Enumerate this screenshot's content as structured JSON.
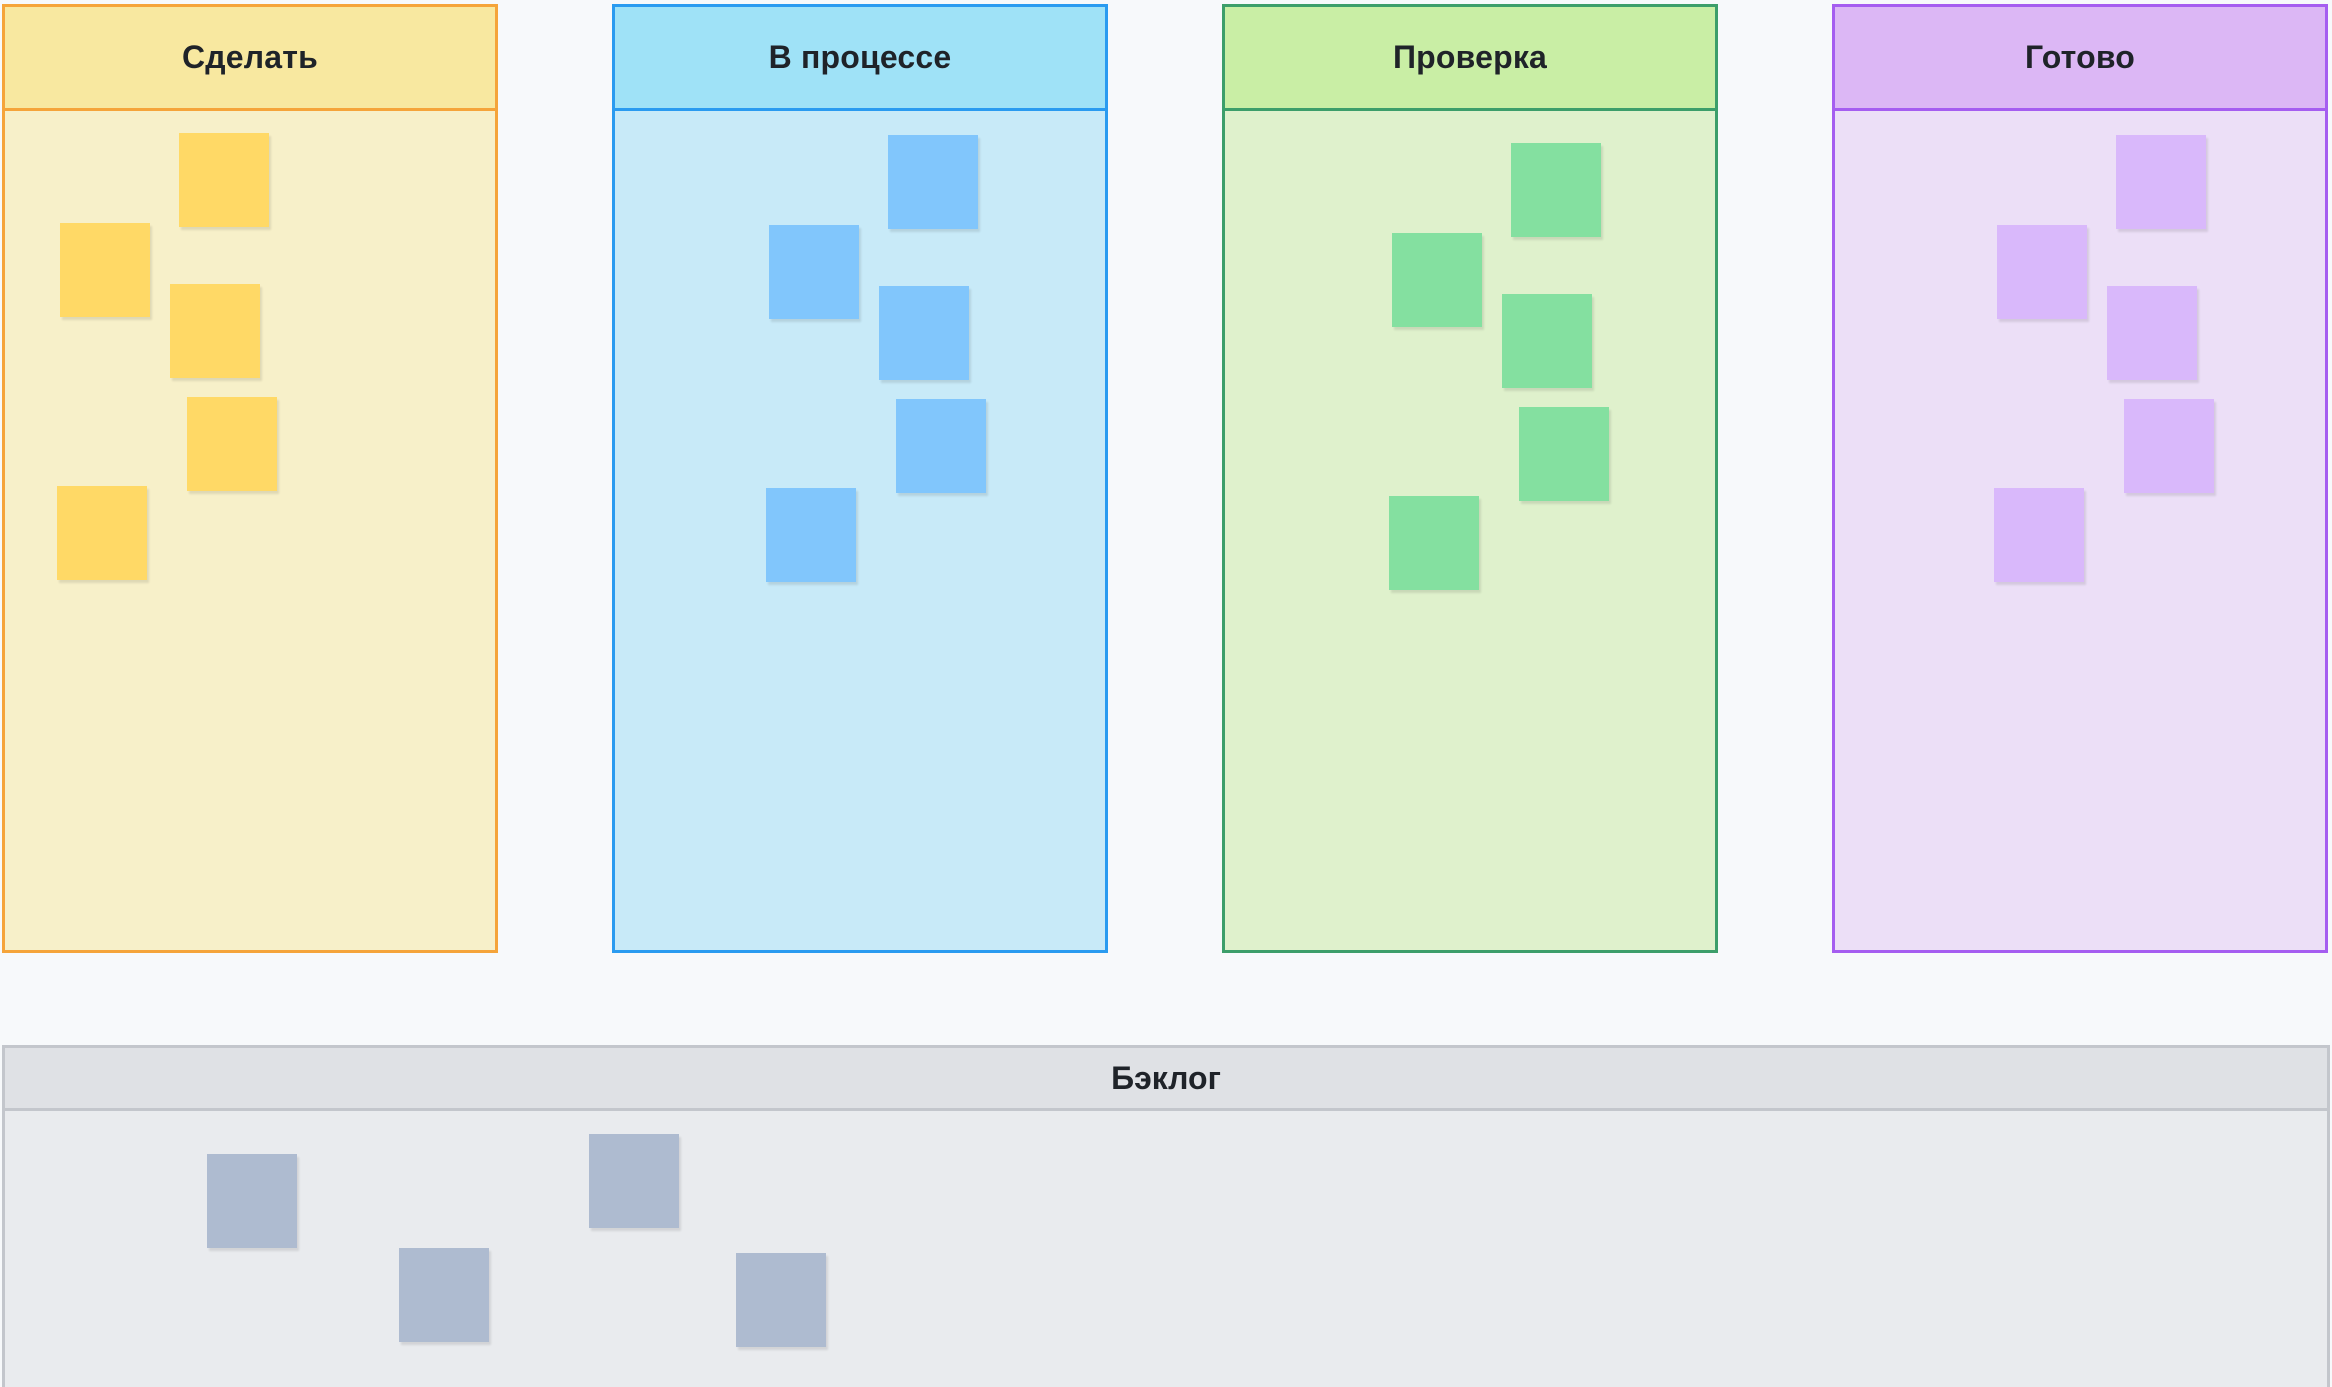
{
  "board": {
    "columns": [
      {
        "id": "todo",
        "title": "Сделать",
        "border_color": "#f5a43a",
        "header_bg": "#f8e8a0",
        "body_bg": "#f7f0c9",
        "sticky_color": "#ffd966",
        "sticky_count": 5
      },
      {
        "id": "progress",
        "title": "В процессе",
        "border_color": "#2a9bf0",
        "header_bg": "#9fe2f7",
        "body_bg": "#c8eaf8",
        "sticky_color": "#81c6fc",
        "sticky_count": 5
      },
      {
        "id": "review",
        "title": "Проверка",
        "border_color": "#3c9e6a",
        "header_bg": "#c9eea5",
        "body_bg": "#dff1cc",
        "sticky_color": "#84e0a0",
        "sticky_count": 5
      },
      {
        "id": "done",
        "title": "Готово",
        "border_color": "#a55df0",
        "header_bg": "#dcb7f5",
        "body_bg": "#ecdff7",
        "sticky_color": "#d9b8fb",
        "sticky_count": 5
      }
    ],
    "backlog": {
      "title": "Бэклог",
      "sticky_color": "#aebbd0",
      "sticky_count": 4
    }
  }
}
